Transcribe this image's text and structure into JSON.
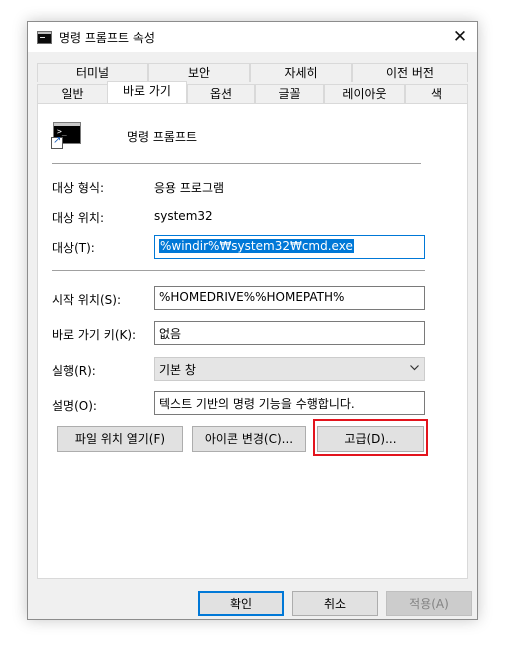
{
  "window": {
    "title": "명령 프롬프트 속성",
    "close_symbol": "✕"
  },
  "tabs": {
    "row_back": [
      "터미널",
      "보안",
      "자세히",
      "이전 버전"
    ],
    "row_front": [
      "일반",
      "바로 가기",
      "옵션",
      "글꼴",
      "레이아웃",
      "색"
    ],
    "selected": "바로 가기"
  },
  "shortcut": {
    "name": "명령 프롬프트",
    "icon": "cmd-icon",
    "target_type_label": "대상 형식:",
    "target_type_value": "응용 프로그램",
    "target_location_label": "대상 위치:",
    "target_location_value": "system32",
    "target_label": "대상(T):",
    "target_value": "%windir%₩system32₩cmd.exe",
    "start_in_label": "시작 위치(S):",
    "start_in_value": "%HOMEDRIVE%%HOMEPATH%",
    "shortcut_key_label": "바로 가기 키(K):",
    "shortcut_key_value": "없음",
    "run_label": "실행(R):",
    "run_value": "기본 창",
    "comment_label": "설명(O):",
    "comment_value": "텍스트 기반의 명령 기능을 수행합니다."
  },
  "buttons": {
    "open_location": "파일 위치 열기(F)",
    "change_icon": "아이콘 변경(C)...",
    "advanced": "고급(D)...",
    "ok": "확인",
    "cancel": "취소",
    "apply": "적용(A)"
  },
  "colors": {
    "highlight": "#e3141d",
    "selection": "#0078d7"
  }
}
